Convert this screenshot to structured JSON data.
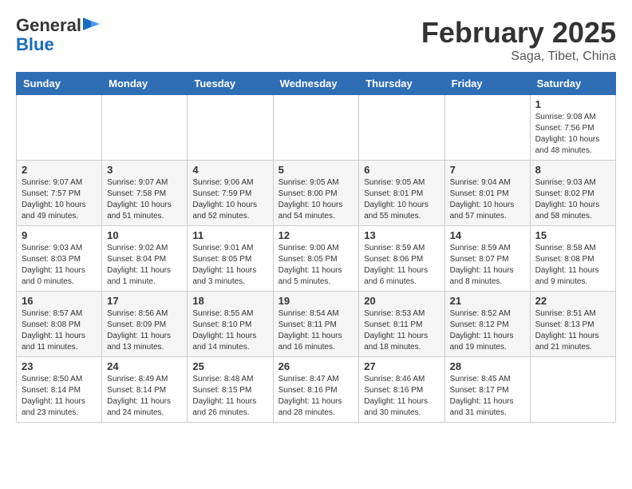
{
  "header": {
    "logo_general": "General",
    "logo_blue": "Blue",
    "month_title": "February 2025",
    "location": "Saga, Tibet, China"
  },
  "days_of_week": [
    "Sunday",
    "Monday",
    "Tuesday",
    "Wednesday",
    "Thursday",
    "Friday",
    "Saturday"
  ],
  "weeks": [
    [
      {
        "day": "",
        "info": ""
      },
      {
        "day": "",
        "info": ""
      },
      {
        "day": "",
        "info": ""
      },
      {
        "day": "",
        "info": ""
      },
      {
        "day": "",
        "info": ""
      },
      {
        "day": "",
        "info": ""
      },
      {
        "day": "1",
        "info": "Sunrise: 9:08 AM\nSunset: 7:56 PM\nDaylight: 10 hours and 48 minutes."
      }
    ],
    [
      {
        "day": "2",
        "info": "Sunrise: 9:07 AM\nSunset: 7:57 PM\nDaylight: 10 hours and 49 minutes."
      },
      {
        "day": "3",
        "info": "Sunrise: 9:07 AM\nSunset: 7:58 PM\nDaylight: 10 hours and 51 minutes."
      },
      {
        "day": "4",
        "info": "Sunrise: 9:06 AM\nSunset: 7:59 PM\nDaylight: 10 hours and 52 minutes."
      },
      {
        "day": "5",
        "info": "Sunrise: 9:05 AM\nSunset: 8:00 PM\nDaylight: 10 hours and 54 minutes."
      },
      {
        "day": "6",
        "info": "Sunrise: 9:05 AM\nSunset: 8:01 PM\nDaylight: 10 hours and 55 minutes."
      },
      {
        "day": "7",
        "info": "Sunrise: 9:04 AM\nSunset: 8:01 PM\nDaylight: 10 hours and 57 minutes."
      },
      {
        "day": "8",
        "info": "Sunrise: 9:03 AM\nSunset: 8:02 PM\nDaylight: 10 hours and 58 minutes."
      }
    ],
    [
      {
        "day": "9",
        "info": "Sunrise: 9:03 AM\nSunset: 8:03 PM\nDaylight: 11 hours and 0 minutes."
      },
      {
        "day": "10",
        "info": "Sunrise: 9:02 AM\nSunset: 8:04 PM\nDaylight: 11 hours and 1 minute."
      },
      {
        "day": "11",
        "info": "Sunrise: 9:01 AM\nSunset: 8:05 PM\nDaylight: 11 hours and 3 minutes."
      },
      {
        "day": "12",
        "info": "Sunrise: 9:00 AM\nSunset: 8:05 PM\nDaylight: 11 hours and 5 minutes."
      },
      {
        "day": "13",
        "info": "Sunrise: 8:59 AM\nSunset: 8:06 PM\nDaylight: 11 hours and 6 minutes."
      },
      {
        "day": "14",
        "info": "Sunrise: 8:59 AM\nSunset: 8:07 PM\nDaylight: 11 hours and 8 minutes."
      },
      {
        "day": "15",
        "info": "Sunrise: 8:58 AM\nSunset: 8:08 PM\nDaylight: 11 hours and 9 minutes."
      }
    ],
    [
      {
        "day": "16",
        "info": "Sunrise: 8:57 AM\nSunset: 8:08 PM\nDaylight: 11 hours and 11 minutes."
      },
      {
        "day": "17",
        "info": "Sunrise: 8:56 AM\nSunset: 8:09 PM\nDaylight: 11 hours and 13 minutes."
      },
      {
        "day": "18",
        "info": "Sunrise: 8:55 AM\nSunset: 8:10 PM\nDaylight: 11 hours and 14 minutes."
      },
      {
        "day": "19",
        "info": "Sunrise: 8:54 AM\nSunset: 8:11 PM\nDaylight: 11 hours and 16 minutes."
      },
      {
        "day": "20",
        "info": "Sunrise: 8:53 AM\nSunset: 8:11 PM\nDaylight: 11 hours and 18 minutes."
      },
      {
        "day": "21",
        "info": "Sunrise: 8:52 AM\nSunset: 8:12 PM\nDaylight: 11 hours and 19 minutes."
      },
      {
        "day": "22",
        "info": "Sunrise: 8:51 AM\nSunset: 8:13 PM\nDaylight: 11 hours and 21 minutes."
      }
    ],
    [
      {
        "day": "23",
        "info": "Sunrise: 8:50 AM\nSunset: 8:14 PM\nDaylight: 11 hours and 23 minutes."
      },
      {
        "day": "24",
        "info": "Sunrise: 8:49 AM\nSunset: 8:14 PM\nDaylight: 11 hours and 24 minutes."
      },
      {
        "day": "25",
        "info": "Sunrise: 8:48 AM\nSunset: 8:15 PM\nDaylight: 11 hours and 26 minutes."
      },
      {
        "day": "26",
        "info": "Sunrise: 8:47 AM\nSunset: 8:16 PM\nDaylight: 11 hours and 28 minutes."
      },
      {
        "day": "27",
        "info": "Sunrise: 8:46 AM\nSunset: 8:16 PM\nDaylight: 11 hours and 30 minutes."
      },
      {
        "day": "28",
        "info": "Sunrise: 8:45 AM\nSunset: 8:17 PM\nDaylight: 11 hours and 31 minutes."
      },
      {
        "day": "",
        "info": ""
      }
    ]
  ]
}
